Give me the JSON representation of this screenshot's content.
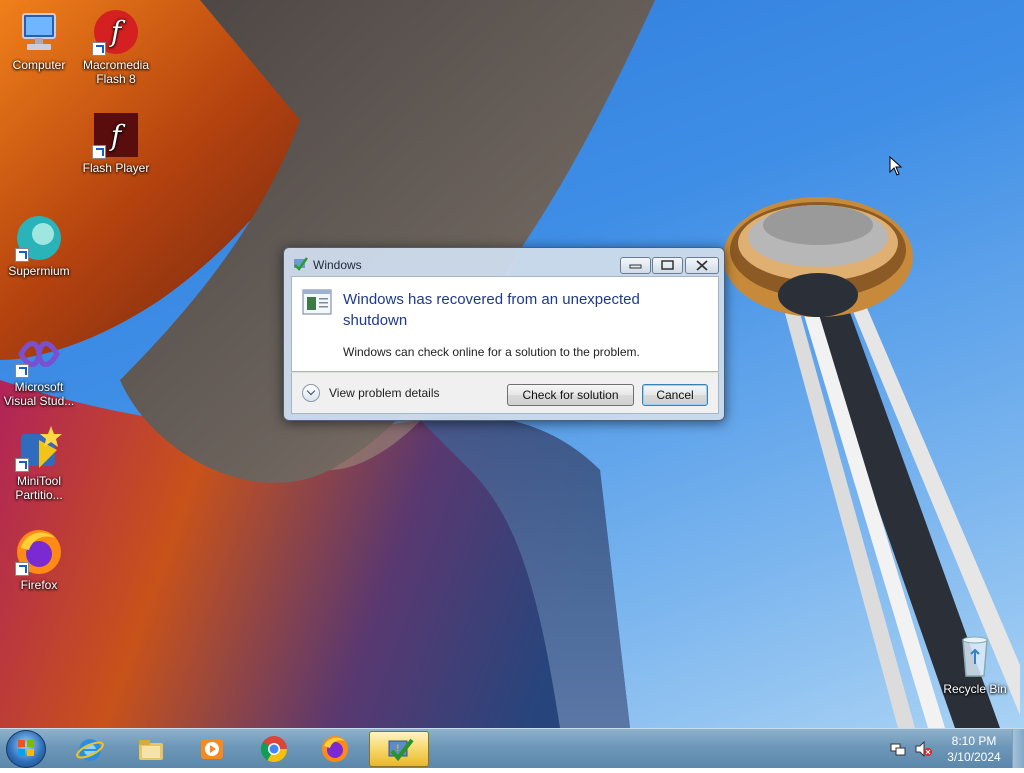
{
  "desktop": {
    "icons": [
      {
        "label": "Computer"
      },
      {
        "label": "Macromedia Flash 8"
      },
      {
        "label": "Flash Player"
      },
      {
        "label": "Supermium"
      },
      {
        "label": "Microsoft Visual Stud..."
      },
      {
        "label": "MiniTool Partitio..."
      },
      {
        "label": "Firefox"
      },
      {
        "label": "Recycle Bin"
      }
    ]
  },
  "dialog": {
    "title": "Windows",
    "main_instruction": "Windows has recovered from an unexpected shutdown",
    "content": "Windows can check online for a solution to the problem.",
    "expander_label": "View problem details",
    "check_button": "Check for solution",
    "cancel_button": "Cancel"
  },
  "taskbar": {
    "pinned": [
      {
        "name": "internet-explorer",
        "icon": "ie-icon"
      },
      {
        "name": "file-explorer",
        "icon": "folder-icon"
      },
      {
        "name": "media-player",
        "icon": "media-player-icon"
      },
      {
        "name": "chrome",
        "icon": "chrome-icon"
      },
      {
        "name": "firefox",
        "icon": "firefox-icon"
      },
      {
        "name": "action-center-dialog",
        "icon": "flag-check-icon",
        "active": true
      }
    ],
    "clock": {
      "time": "8:10 PM",
      "date": "3/10/2024"
    }
  },
  "colors": {
    "taskbar": "#6d97b8",
    "dialog_instruction": "#1e3a8a",
    "sky": "#2a78d8"
  }
}
